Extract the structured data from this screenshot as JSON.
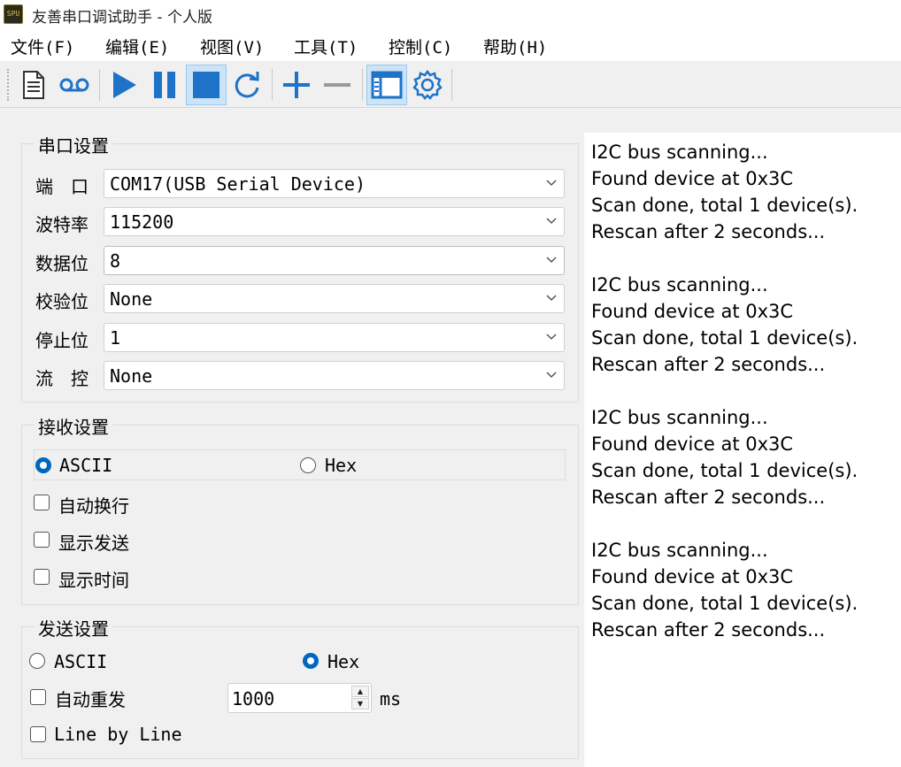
{
  "window": {
    "title": "友善串口调试助手 - 个人版",
    "app_icon_text": "SPU"
  },
  "menu": {
    "items": [
      "文件(F)",
      "编辑(E)",
      "视图(V)",
      "工具(T)",
      "控制(C)",
      "帮助(H)"
    ]
  },
  "toolbar": {
    "buttons": [
      "new-document-icon",
      "record-icon",
      "play-icon",
      "pause-icon",
      "stop-icon",
      "refresh-icon",
      "add-icon",
      "remove-icon",
      "window-icon",
      "settings-icon"
    ],
    "accent_color": "#1e73c8",
    "active_buttons": [
      "stop-icon",
      "window-icon"
    ]
  },
  "serial_settings": {
    "title": "串口设置",
    "fields": [
      {
        "label": "端　口",
        "value": "COM17(USB Serial Device)"
      },
      {
        "label": "波特率",
        "value": "115200"
      },
      {
        "label": "数据位",
        "value": "8"
      },
      {
        "label": "校验位",
        "value": "None"
      },
      {
        "label": "停止位",
        "value": "1"
      },
      {
        "label": "流　控",
        "value": "None"
      }
    ]
  },
  "receive_settings": {
    "title": "接收设置",
    "mode_ascii": "ASCII",
    "mode_hex": "Hex",
    "selected_mode": "ASCII",
    "options": [
      {
        "label": "自动换行",
        "checked": false
      },
      {
        "label": "显示发送",
        "checked": false
      },
      {
        "label": "显示时间",
        "checked": false
      }
    ]
  },
  "send_settings": {
    "title": "发送设置",
    "mode_ascii": "ASCII",
    "mode_hex": "Hex",
    "selected_mode": "Hex",
    "auto_resend_label": "自动重发",
    "auto_resend_checked": false,
    "interval_value": "1000",
    "interval_unit": "ms",
    "line_by_line_label": "Line by Line",
    "line_by_line_checked": false
  },
  "receive_area": {
    "lines": [
      "I2C bus scanning...",
      "Found device at 0x3C",
      "Scan done, total 1 device(s).",
      "Rescan after 2 seconds...",
      "",
      "I2C bus scanning...",
      "Found device at 0x3C",
      "Scan done, total 1 device(s).",
      "Rescan after 2 seconds...",
      "",
      "I2C bus scanning...",
      "Found device at 0x3C",
      "Scan done, total 1 device(s).",
      "Rescan after 2 seconds...",
      "",
      "I2C bus scanning...",
      "Found device at 0x3C",
      "Scan done, total 1 device(s).",
      "Rescan after 2 seconds..."
    ]
  }
}
